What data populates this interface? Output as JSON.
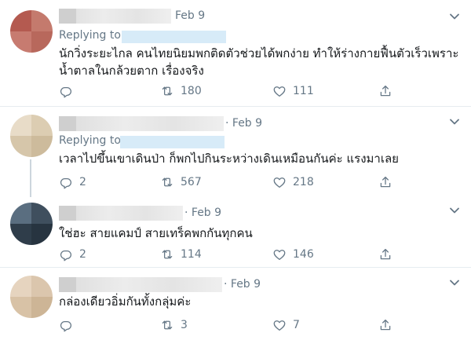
{
  "icons": {
    "reply": "comment-icon",
    "retweet": "retweet-icon",
    "like": "heart-icon",
    "share": "share-icon",
    "more": "chevron-down-icon"
  },
  "colors": {
    "muted": "#657786",
    "link_blur": "#d7ebf8",
    "divider": "#e6ecf0"
  },
  "tweets": [
    {
      "date": "Feb 9",
      "replying_to": "Replying to",
      "text": "นักวิ่งระยะไกล คนไทยนิยมพกติดตัวช่วยได้พกง่าย ทำให้ร่างกายฟื้นตัวเร็วเพราะ\nน้ำตาลในกล้วยตาก เรื่องจริง",
      "replies": "",
      "retweets": "180",
      "likes": "111"
    },
    {
      "date": "· Feb 9",
      "replying_to": "Replying to",
      "text": "เวลาไปขึ้นเขาเดินป่า ก็พกไปกินระหว่างเดินเหมือนกันค่ะ แรงมาเลย",
      "replies": "2",
      "retweets": "567",
      "likes": "218"
    },
    {
      "date": "· Feb 9",
      "text": "ใช่ฮะ สายแคมป์ สายเทร็คพกกันทุกคน",
      "replies": "2",
      "retweets": "114",
      "likes": "146"
    },
    {
      "date": "· Feb 9",
      "text": "กล่องเดียวอิ่มกันทั้งกลุ่มค่ะ",
      "replies": "",
      "retweets": "3",
      "likes": "7"
    }
  ]
}
